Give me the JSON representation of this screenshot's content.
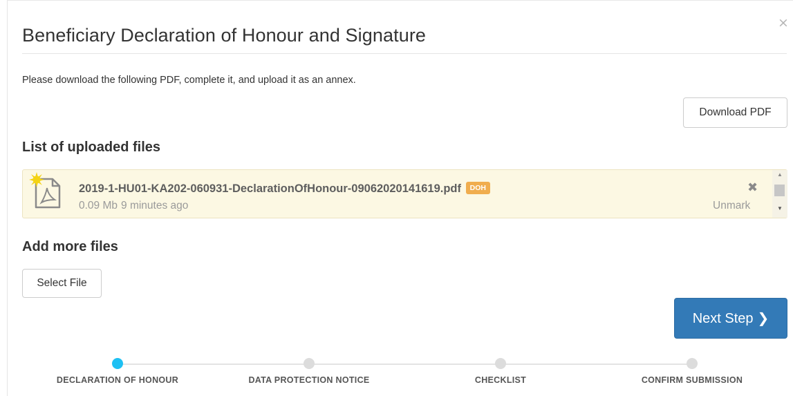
{
  "modal": {
    "title": "Beneficiary Declaration of Honour and Signature",
    "close_glyph": "×",
    "instructions": "Please download the following PDF, complete it, and upload it as an annex.",
    "download_button": "Download PDF",
    "uploaded_heading": "List of uploaded files",
    "add_heading": "Add more files",
    "select_button": "Select File",
    "next_button": "Next Step",
    "next_chevron": "❯"
  },
  "file": {
    "name": "2019-1-HU01-KA202-060931-DeclarationOfHonour-09062020141619.pdf",
    "badge": "DOH",
    "size": "0.09 Mb",
    "age": "9 minutes ago",
    "remove_glyph": "✖",
    "unmark_label": "Unmark",
    "icon": "pdf-file-icon",
    "new_marker_icon": "star-icon"
  },
  "steps": [
    {
      "label": "DECLARATION OF HONOUR",
      "active": true
    },
    {
      "label": "DATA PROTECTION NOTICE",
      "active": false
    },
    {
      "label": "CHECKLIST",
      "active": false
    },
    {
      "label": "CONFIRM SUBMISSION",
      "active": false
    }
  ],
  "colors": {
    "primary": "#337ab7",
    "active_step": "#1ec0f3",
    "badge": "#f0ad4e",
    "file_highlight": "#fcf8e3"
  }
}
